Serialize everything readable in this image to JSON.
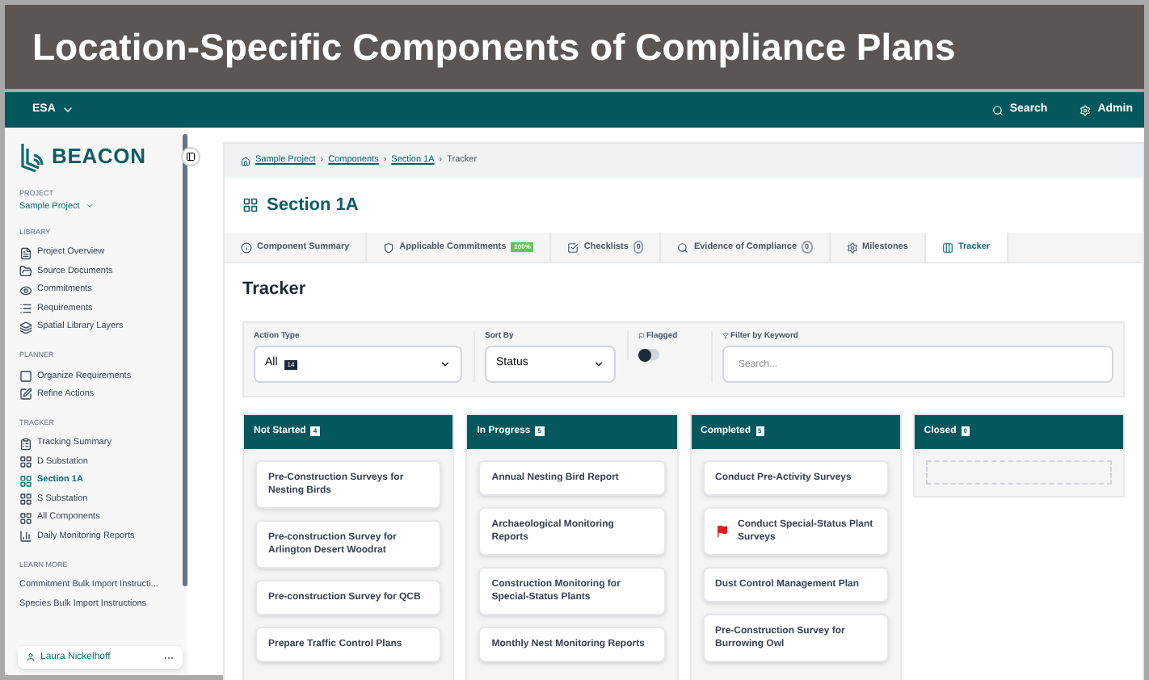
{
  "banner": {
    "title": "Location-Specific Components of Compliance Plans"
  },
  "topbar": {
    "org": "ESA",
    "search": "Search",
    "admin": "Admin"
  },
  "sidebar": {
    "logo": "BEACON",
    "project_label": "PROJECT",
    "project": "Sample Project",
    "sections": [
      {
        "label": "LIBRARY",
        "items": [
          {
            "label": "Project Overview",
            "selected": false
          },
          {
            "label": "Source Documents",
            "selected": false
          },
          {
            "label": "Commitments",
            "selected": false
          },
          {
            "label": "Requirements",
            "selected": false
          },
          {
            "label": "Spatial Library Layers",
            "selected": false
          }
        ]
      },
      {
        "label": "PLANNER",
        "items": [
          {
            "label": "Organize Requirements",
            "selected": false
          },
          {
            "label": "Refine Actions",
            "selected": false
          }
        ]
      },
      {
        "label": "TRACKER",
        "items": [
          {
            "label": "Tracking Summary",
            "selected": false
          },
          {
            "label": "D Substation",
            "selected": false
          },
          {
            "label": "Section 1A",
            "selected": true
          },
          {
            "label": "S Substation",
            "selected": false
          },
          {
            "label": "All Components",
            "selected": false
          },
          {
            "label": "Daily Monitoring Reports",
            "selected": false
          }
        ]
      },
      {
        "label": "LEARN MORE",
        "items": [
          {
            "label": "Commitment Bulk Import Instructi...",
            "selected": false
          },
          {
            "label": "Species Bulk Import Instructions",
            "selected": false
          }
        ]
      }
    ],
    "user": "Laura Nickelhoff"
  },
  "breadcrumb": [
    {
      "label": "Sample Project",
      "link": true
    },
    {
      "separator": "›",
      "label": "Components",
      "link": true
    },
    {
      "separator": "›",
      "label": "Section 1A",
      "link": true
    },
    {
      "separator": "›",
      "label": "Tracker",
      "link": false
    }
  ],
  "page_title": "Section 1A",
  "tabs": [
    {
      "label": "Component Summary",
      "selected": false
    },
    {
      "label": "Applicable Commitments",
      "badge": "100%",
      "selected": false
    },
    {
      "label": "Checklists",
      "badge": "0",
      "selected": false
    },
    {
      "label": "Evidence of Compliance",
      "badge": "0",
      "selected": false
    },
    {
      "label": "Milestones",
      "selected": false
    },
    {
      "label": "Tracker",
      "selected": true
    }
  ],
  "section_title": "Tracker",
  "filters": {
    "action_type": {
      "label": "Action Type",
      "value": "All",
      "count": "14"
    },
    "sort_by": {
      "label": "Sort By",
      "value": "Status"
    },
    "flagged": {
      "label": "Flagged",
      "on": false
    },
    "keyword": {
      "label": "Filter by Keyword",
      "placeholder": "Search..."
    }
  },
  "columns": [
    {
      "title": "Not Started",
      "count": "4",
      "cards": [
        {
          "title": "Pre-Construction Surveys for Nesting Birds",
          "flagged": false
        },
        {
          "title": "Pre-construction Survey for Arlington Desert Woodrat",
          "flagged": false
        },
        {
          "title": "Pre-construction Survey for QCB",
          "flagged": false
        },
        {
          "title": "Prepare Traffic Control Plans",
          "flagged": false
        }
      ]
    },
    {
      "title": "In Progress",
      "count": "5",
      "cards": [
        {
          "title": "Annual Nesting Bird Report",
          "flagged": false
        },
        {
          "title": "Archaeological Monitoring Reports",
          "flagged": false
        },
        {
          "title": "Construction Monitoring for Special-Status Plants",
          "flagged": false
        },
        {
          "title": "Monthly Nest Monitoring Reports",
          "flagged": false
        }
      ]
    },
    {
      "title": "Completed",
      "count": "5",
      "cards": [
        {
          "title": "Conduct Pre-Activity Surveys",
          "flagged": false
        },
        {
          "title": "Conduct Special-Status Plant Surveys",
          "flagged": true
        },
        {
          "title": "Dust Control Management Plan",
          "flagged": false
        },
        {
          "title": "Pre-Construction Survey for Burrowing Owl",
          "flagged": false
        }
      ]
    },
    {
      "title": "Closed",
      "count": "0"
    }
  ]
}
